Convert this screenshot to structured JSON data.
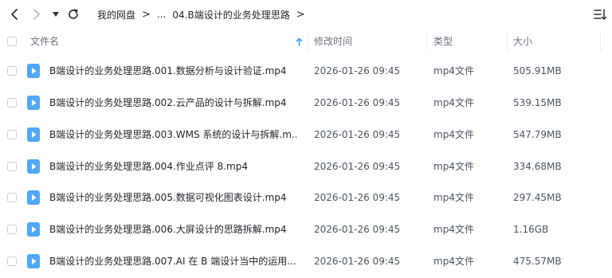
{
  "breadcrumb": {
    "root": "我的网盘",
    "ellipsis": "...",
    "current": "04.B端设计的业务处理思路"
  },
  "columns": {
    "name": "文件名",
    "modified": "修改时间",
    "type": "类型",
    "size": "大小"
  },
  "files": [
    {
      "name": "B端设计的业务处理思路.001.数据分析与设计验证.mp4",
      "modified": "2026-01-26 09:45",
      "type": "mp4文件",
      "size": "505.91MB"
    },
    {
      "name": "B端设计的业务处理思路.002.云产品的设计与拆解.mp4",
      "modified": "2026-01-26 09:45",
      "type": "mp4文件",
      "size": "539.15MB"
    },
    {
      "name": "B端设计的业务处理思路.003.WMS 系统的设计与拆解.m...",
      "modified": "2026-01-26 09:45",
      "type": "mp4文件",
      "size": "547.79MB"
    },
    {
      "name": "B端设计的业务处理思路.004.作业点评 8.mp4",
      "modified": "2026-01-26 09:45",
      "type": "mp4文件",
      "size": "334.68MB"
    },
    {
      "name": "B端设计的业务处理思路.005.数据可视化图表设计.mp4",
      "modified": "2026-01-26 09:45",
      "type": "mp4文件",
      "size": "297.45MB"
    },
    {
      "name": "B端设计的业务处理思路.006.大屏设计的思路拆解.mp4",
      "modified": "2026-01-26 09:45",
      "type": "mp4文件",
      "size": "1.16GB"
    },
    {
      "name": "B端设计的业务处理思路.007.AI 在 B 端设计当中的运用....",
      "modified": "2026-01-26 09:45",
      "type": "mp4文件",
      "size": "475.57MB"
    }
  ],
  "colors": {
    "accent": "#3f9bf7",
    "icon_fill": "#4fa8f8"
  },
  "icons": {
    "back": "chevron-left",
    "forward": "chevron-right",
    "history": "triangle-down",
    "refresh": "refresh",
    "sort": "sort-list",
    "sort_direction": "arrow-up"
  }
}
